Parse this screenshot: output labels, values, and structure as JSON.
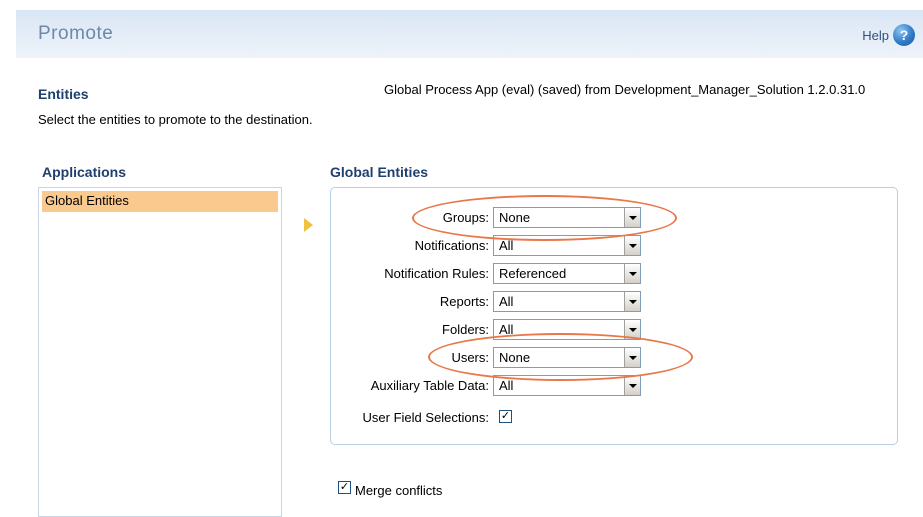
{
  "header": {
    "title": "Promote",
    "help_label": "Help",
    "help_icon": "question-mark-circle-icon"
  },
  "entities_heading": "Entities",
  "instructions": "Select the entities to promote to the destination.",
  "source_info": "Global Process App (eval) (saved) from Development_Manager_Solution 1.2.0.31.0",
  "applications": {
    "heading": "Applications",
    "items": [
      "Global Entities"
    ],
    "selected": "Global Entities"
  },
  "global_entities": {
    "heading": "Global Entities",
    "fields": [
      {
        "label": "Groups:",
        "value": "None"
      },
      {
        "label": "Notifications:",
        "value": "All"
      },
      {
        "label": "Notification Rules:",
        "value": "Referenced"
      },
      {
        "label": "Reports:",
        "value": "All"
      },
      {
        "label": "Folders:",
        "value": "All"
      },
      {
        "label": "Users:",
        "value": "None"
      },
      {
        "label": "Auxiliary Table Data:",
        "value": "All"
      }
    ],
    "user_field_selections": {
      "label": "User Field Selections:",
      "checked": true
    }
  },
  "merge_conflicts": {
    "label": "Merge conflicts",
    "checked": true
  },
  "colors": {
    "highlight_ellipse": "#e8784a",
    "selected_item": "#f9c98e",
    "heading": "#1f3f6e"
  }
}
